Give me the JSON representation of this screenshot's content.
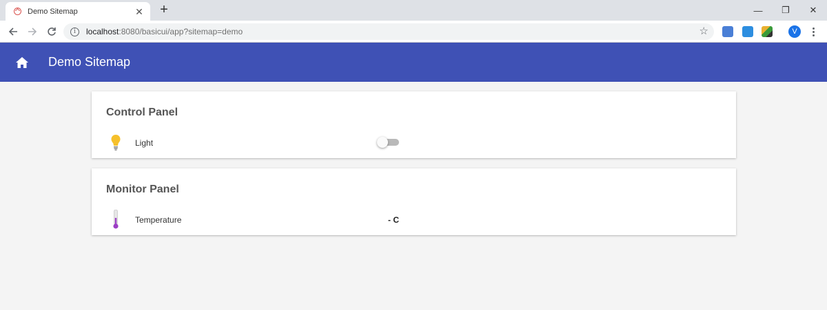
{
  "browser": {
    "tab_title": "Demo Sitemap",
    "tab_close": "✕",
    "new_tab": "+",
    "url_host": "localhost",
    "url_rest": ":8080/basicui/app?sitemap=demo",
    "avatar_letter": "V",
    "controls": {
      "minimize": "—",
      "restore": "❐",
      "close": "✕"
    }
  },
  "app": {
    "title": "Demo Sitemap",
    "header_color": "#3f51b5"
  },
  "control_panel": {
    "title": "Control Panel",
    "item_label": "Light",
    "switch_state": "off"
  },
  "monitor_panel": {
    "title": "Monitor Panel",
    "item_label": "Temperature",
    "item_value": "- C"
  }
}
